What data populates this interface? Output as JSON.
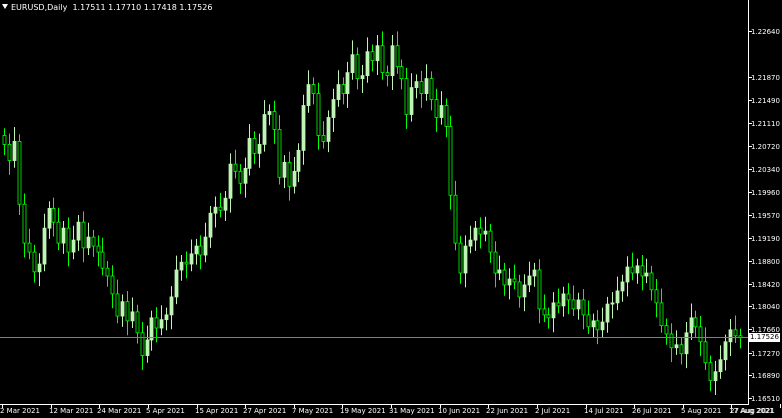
{
  "header": {
    "symbol": "EURUSD,Daily",
    "ohlc": "1.17511 1.17710 1.17418 1.17526"
  },
  "current_price_label": "1.17526",
  "colors": {
    "background": "#000000",
    "bull": "#BFF5B4",
    "bear": "#00FF00",
    "axis": "#FFFFFF",
    "price_line": "#7F7F7F"
  },
  "chart_data": {
    "type": "candlestick",
    "symbol": "EURUSD",
    "timeframe": "Daily",
    "y_ticks": [
      "1.22640",
      "1.21870",
      "1.21490",
      "1.21110",
      "1.20720",
      "1.20340",
      "1.19960",
      "1.19570",
      "1.19190",
      "1.18800",
      "1.18420",
      "1.18040",
      "1.17660",
      "1.17270",
      "1.16890",
      "1.16510"
    ],
    "x_ticks": [
      "2 Mar 2021",
      "12 Mar 2021",
      "24 Mar 2021",
      "5 Apr 2021",
      "15 Apr 2021",
      "27 Apr 2021",
      "7 May 2021",
      "19 May 2021",
      "31 May 2021",
      "10 Jun 2021",
      "22 Jun 2021",
      "2 Jul 2021",
      "14 Jul 2021",
      "26 Jul 2021",
      "5 Aug 2021",
      "17 Aug 2021",
      "27 Aug 2021"
    ],
    "last_price": 1.17526,
    "ylim": [
      1.1651,
      1.2283
    ],
    "candles_close": [
      1.2075,
      1.2048,
      1.208,
      1.1975,
      1.191,
      1.1895,
      1.1862,
      1.1875,
      1.1935,
      1.1968,
      1.1945,
      1.191,
      1.1935,
      1.1895,
      1.1915,
      1.1945,
      1.1902,
      1.192,
      1.1905,
      1.1895,
      1.1868,
      1.1855,
      1.1825,
      1.1788,
      1.1812,
      1.178,
      1.1795,
      1.176,
      1.1722,
      1.1748,
      1.1785,
      1.1768,
      1.1782,
      1.179,
      1.182,
      1.1865,
      1.1878,
      1.1875,
      1.1892,
      1.1905,
      1.189,
      1.192,
      1.196,
      1.197,
      1.1965,
      1.1985,
      1.2042,
      1.203,
      1.201,
      1.2035,
      1.2085,
      1.206,
      1.2075,
      1.2125,
      1.213,
      1.21,
      1.202,
      1.2045,
      1.2005,
      1.203,
      1.2065,
      1.214,
      1.2175,
      1.216,
      1.209,
      1.208,
      1.212,
      1.215,
      1.2175,
      1.216,
      1.2195,
      1.2225,
      1.2185,
      1.219,
      1.223,
      1.2215,
      1.224,
      1.2195,
      1.219,
      1.224,
      1.2205,
      1.2185,
      1.2125,
      1.217,
      1.218,
      1.216,
      1.2185,
      1.215,
      1.212,
      1.214,
      1.2105,
      1.199,
      1.191,
      1.186,
      1.1905,
      1.1915,
      1.1935,
      1.1925,
      1.193,
      1.1895,
      1.186,
      1.1865,
      1.184,
      1.185,
      1.1845,
      1.182,
      1.184,
      1.1855,
      1.1865,
      1.18,
      1.179,
      1.1785,
      1.181,
      1.1805,
      1.1825,
      1.1815,
      1.18,
      1.1815,
      1.179,
      1.177,
      1.178,
      1.1765,
      1.1778,
      1.1808,
      1.181,
      1.183,
      1.1845,
      1.187,
      1.186,
      1.1872,
      1.1855,
      1.186,
      1.1832,
      1.181,
      1.1772,
      1.1758,
      1.1735,
      1.174,
      1.1725,
      1.176,
      1.1785,
      1.177,
      1.1745,
      1.171,
      1.168,
      1.1695,
      1.1715,
      1.1745,
      1.1765,
      1.1755,
      1.1752
    ]
  }
}
